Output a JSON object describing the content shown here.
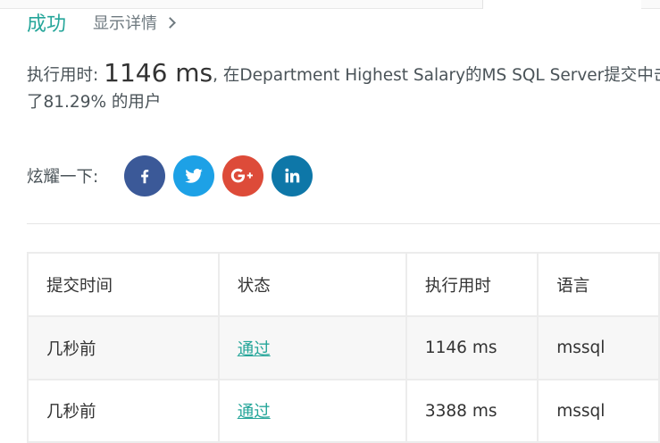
{
  "result": {
    "status": "成功",
    "details_link": "显示详情",
    "runtime_label": "执行用时:",
    "runtime_value": "1146 ms",
    "sentence_part1": ", 在Department Highest Salary的MS SQL Server提交中击",
    "sentence_part2": "了81.29% 的用户"
  },
  "share": {
    "label": "炫耀一下:",
    "buttons": [
      {
        "name": "facebook",
        "icon": "facebook-icon",
        "color": "#3b5998"
      },
      {
        "name": "twitter",
        "icon": "twitter-icon",
        "color": "#1da1e6"
      },
      {
        "name": "google-plus",
        "icon": "google-plus-icon",
        "color": "#dd4b39"
      },
      {
        "name": "linkedin",
        "icon": "linkedin-icon",
        "color": "#0e77a8"
      }
    ]
  },
  "table": {
    "headers": [
      "提交时间",
      "状态",
      "执行用时",
      "语言"
    ],
    "rows": [
      {
        "time": "几秒前",
        "status": "通过",
        "runtime": "1146 ms",
        "language": "mssql"
      },
      {
        "time": "几秒前",
        "status": "通过",
        "runtime": "3388 ms",
        "language": "mssql"
      }
    ]
  },
  "colors": {
    "accent": "#26a69a",
    "muted_text": "#6f7a80"
  }
}
